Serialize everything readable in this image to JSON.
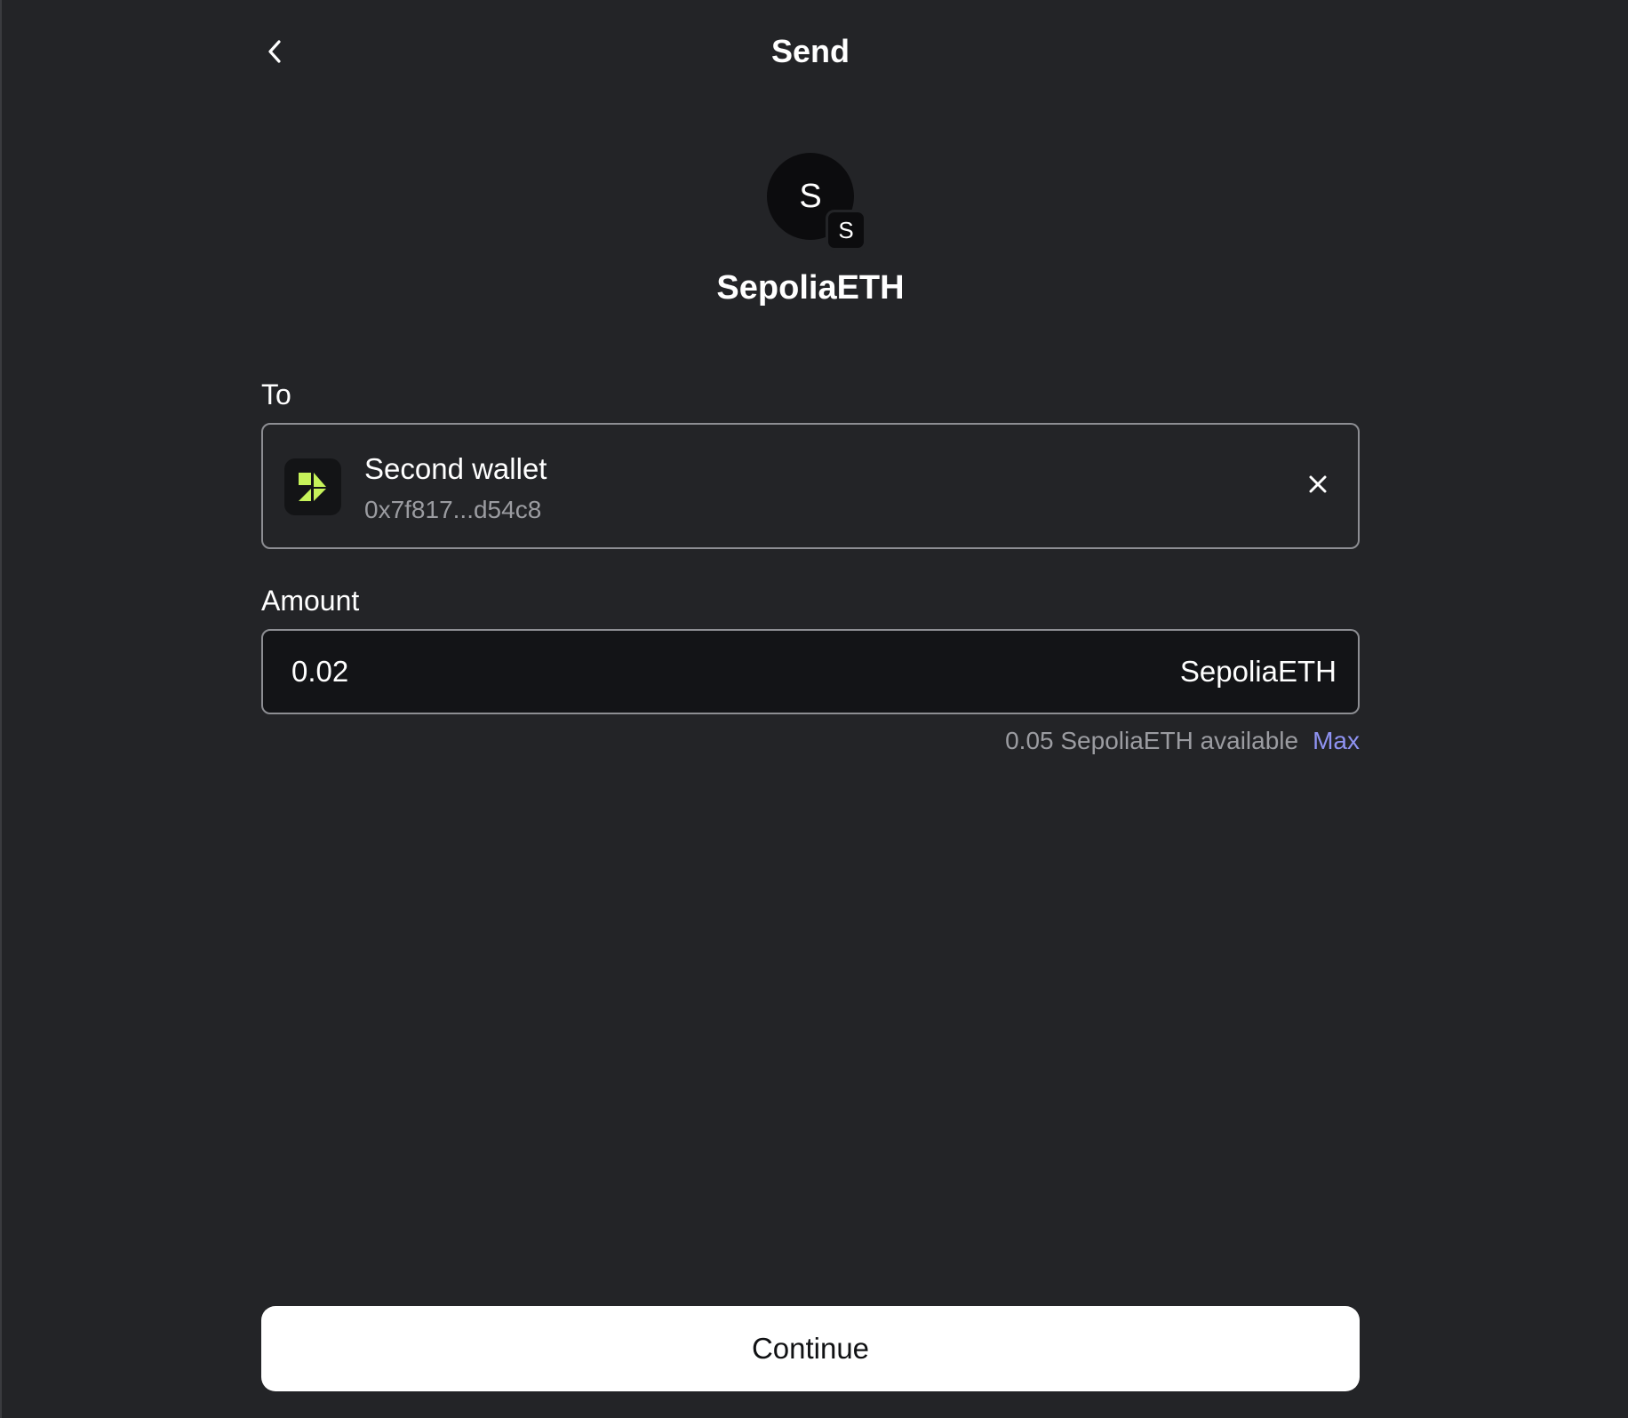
{
  "header": {
    "title": "Send",
    "back_icon": "chevron-left-icon"
  },
  "token": {
    "avatar_letter": "S",
    "badge_letter": "S",
    "name": "SepoliaETH"
  },
  "recipient": {
    "label": "To",
    "wallet_name": "Second wallet",
    "wallet_address": "0x7f817...d54c8",
    "wallet_icon": "wallet-logo-icon",
    "wallet_icon_color": "#c6f35a",
    "clear_icon": "close-icon"
  },
  "amount": {
    "label": "Amount",
    "value": "0.02",
    "unit": "SepoliaETH",
    "available_text": "0.05 SepoliaETH available",
    "max_label": "Max"
  },
  "footer": {
    "continue_label": "Continue"
  },
  "colors": {
    "background": "#232427",
    "accent_link": "#8f93f2",
    "muted_text": "#9b9ca1",
    "button_bg": "#ffffff"
  }
}
